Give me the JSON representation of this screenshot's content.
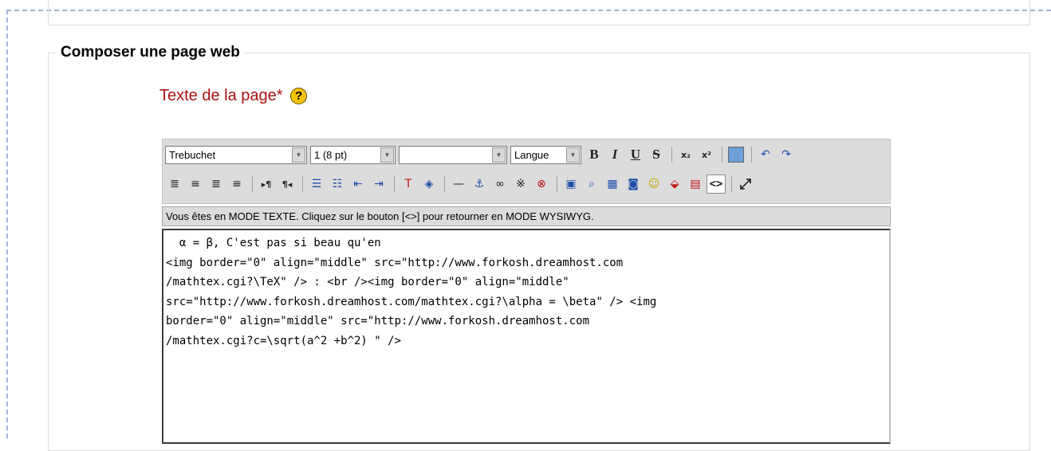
{
  "section": {
    "legend": "Composer une page web",
    "field_label": "Texte de la page*",
    "help_glyph": "?"
  },
  "toolbar": {
    "font_select": "Trebuchet",
    "size_select": "1 (8 pt)",
    "format_select": "",
    "lang_select": "Langue",
    "bold": "B",
    "italic": "I",
    "underline": "U",
    "strike": "S",
    "subscript": "x₂",
    "superscript": "x²",
    "word_paste_icon": "word-paste-icon",
    "undo": "↶",
    "redo": "↷",
    "align_left": "≣",
    "align_center": "≡",
    "align_right": "≣",
    "align_justify": "≡",
    "ltr": "▸¶",
    "rtl": "¶◂",
    "ordered_list": "☰",
    "unordered_list": "☷",
    "outdent": "⇤",
    "indent": "⇥",
    "text_color": "T",
    "bg_color": "◈",
    "hr": "—",
    "anchor": "⚓",
    "link": "∞",
    "unlink": "※",
    "nolink": "⊗",
    "insert_image": "▣",
    "search_replace": "⌕",
    "insert_table": "▦",
    "insert_media": "◙",
    "smiley": "☺",
    "spellcheck": "⬙",
    "clean_html": "▤",
    "html_toggle": "<>",
    "fullscreen": "⤢"
  },
  "status_text": "Vous êtes en MODE TEXTE. Cliquez sur le bouton [<>] pour retourner en MODE WYSIWYG.",
  "editor_text": "  α = β, C'est pas si beau qu'en\n<img border=\"0\" align=\"middle\" src=\"http://www.forkosh.dreamhost.com\n/mathtex.cgi?\\TeX\" /> : <br /><img border=\"0\" align=\"middle\"\nsrc=\"http://www.forkosh.dreamhost.com/mathtex.cgi?\\alpha = \\beta\" /> <img\nborder=\"0\" align=\"middle\" src=\"http://www.forkosh.dreamhost.com\n/mathtex.cgi?c=\\sqrt(a^2 +b^2) \" />",
  "colors": {
    "label_red": "#aa1111",
    "toolbar_bg": "#dcdcdc",
    "dash_blue": "#9fb3cc"
  }
}
